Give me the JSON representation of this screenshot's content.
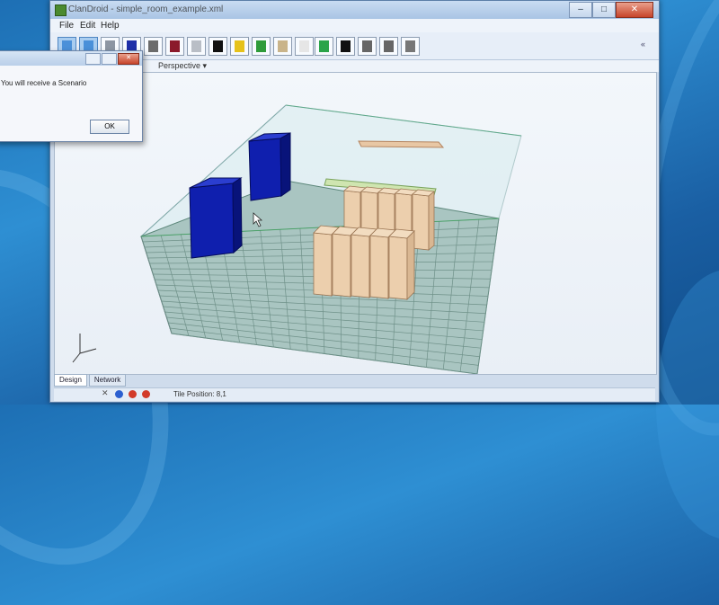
{
  "window": {
    "title": "ClanDroid - simple_room_example.xml",
    "minimize": "–",
    "maximize": "□",
    "close": "✕"
  },
  "menu": {
    "file": "File",
    "edit": "Edit",
    "help": "Help"
  },
  "toolbar": {
    "tools": [
      {
        "icon": "grid-view-icon",
        "color": "#4a90d9"
      },
      {
        "icon": "grid-view-icon",
        "color": "#4a90d9"
      },
      {
        "icon": "gray-cabinet-icon",
        "color": "#8d96a3"
      },
      {
        "icon": "blue-cabinet-icon",
        "color": "#1d2ea8"
      },
      {
        "icon": "server-rack-icon",
        "color": "#6b6b6b"
      },
      {
        "icon": "red-rack-icon",
        "color": "#8b1a2b"
      },
      {
        "icon": "gray-panel-icon",
        "color": "#b9bec6"
      },
      {
        "icon": "black-box-icon",
        "color": "#111111"
      },
      {
        "icon": "yellow-star-icon",
        "color": "#e6c21a"
      },
      {
        "icon": "green-ramp-icon",
        "color": "#2f9b3a"
      },
      {
        "icon": "door-icon",
        "color": "#c9b48a"
      },
      {
        "icon": "white-grid-icon",
        "color": "#e6e6e6"
      },
      {
        "icon": "green-tile-icon",
        "color": "#2aa44a"
      },
      {
        "icon": "compass-icon",
        "color": "#111111"
      },
      {
        "icon": "transform-icon",
        "color": "#666666"
      },
      {
        "icon": "arrows-icon",
        "color": "#666666"
      },
      {
        "icon": "cylinder-icon",
        "color": "#777777"
      }
    ],
    "collapse": "«"
  },
  "view": {
    "projection": "Perspective ▾"
  },
  "tabs": [
    {
      "label": "Design"
    },
    {
      "label": "Network"
    }
  ],
  "status": {
    "tile_position": "Tile Position: 8,1"
  },
  "dialog": {
    "message": "You will receive a Scenario",
    "ok": "OK"
  },
  "colors": {
    "floor": "#a7c3c0",
    "floor_lines": "#59806f",
    "wall_fill": "#cfe6ea",
    "blue_cabinet": "#0d1aa5",
    "box": "#e9caa8",
    "accent_green": "#24a148"
  }
}
